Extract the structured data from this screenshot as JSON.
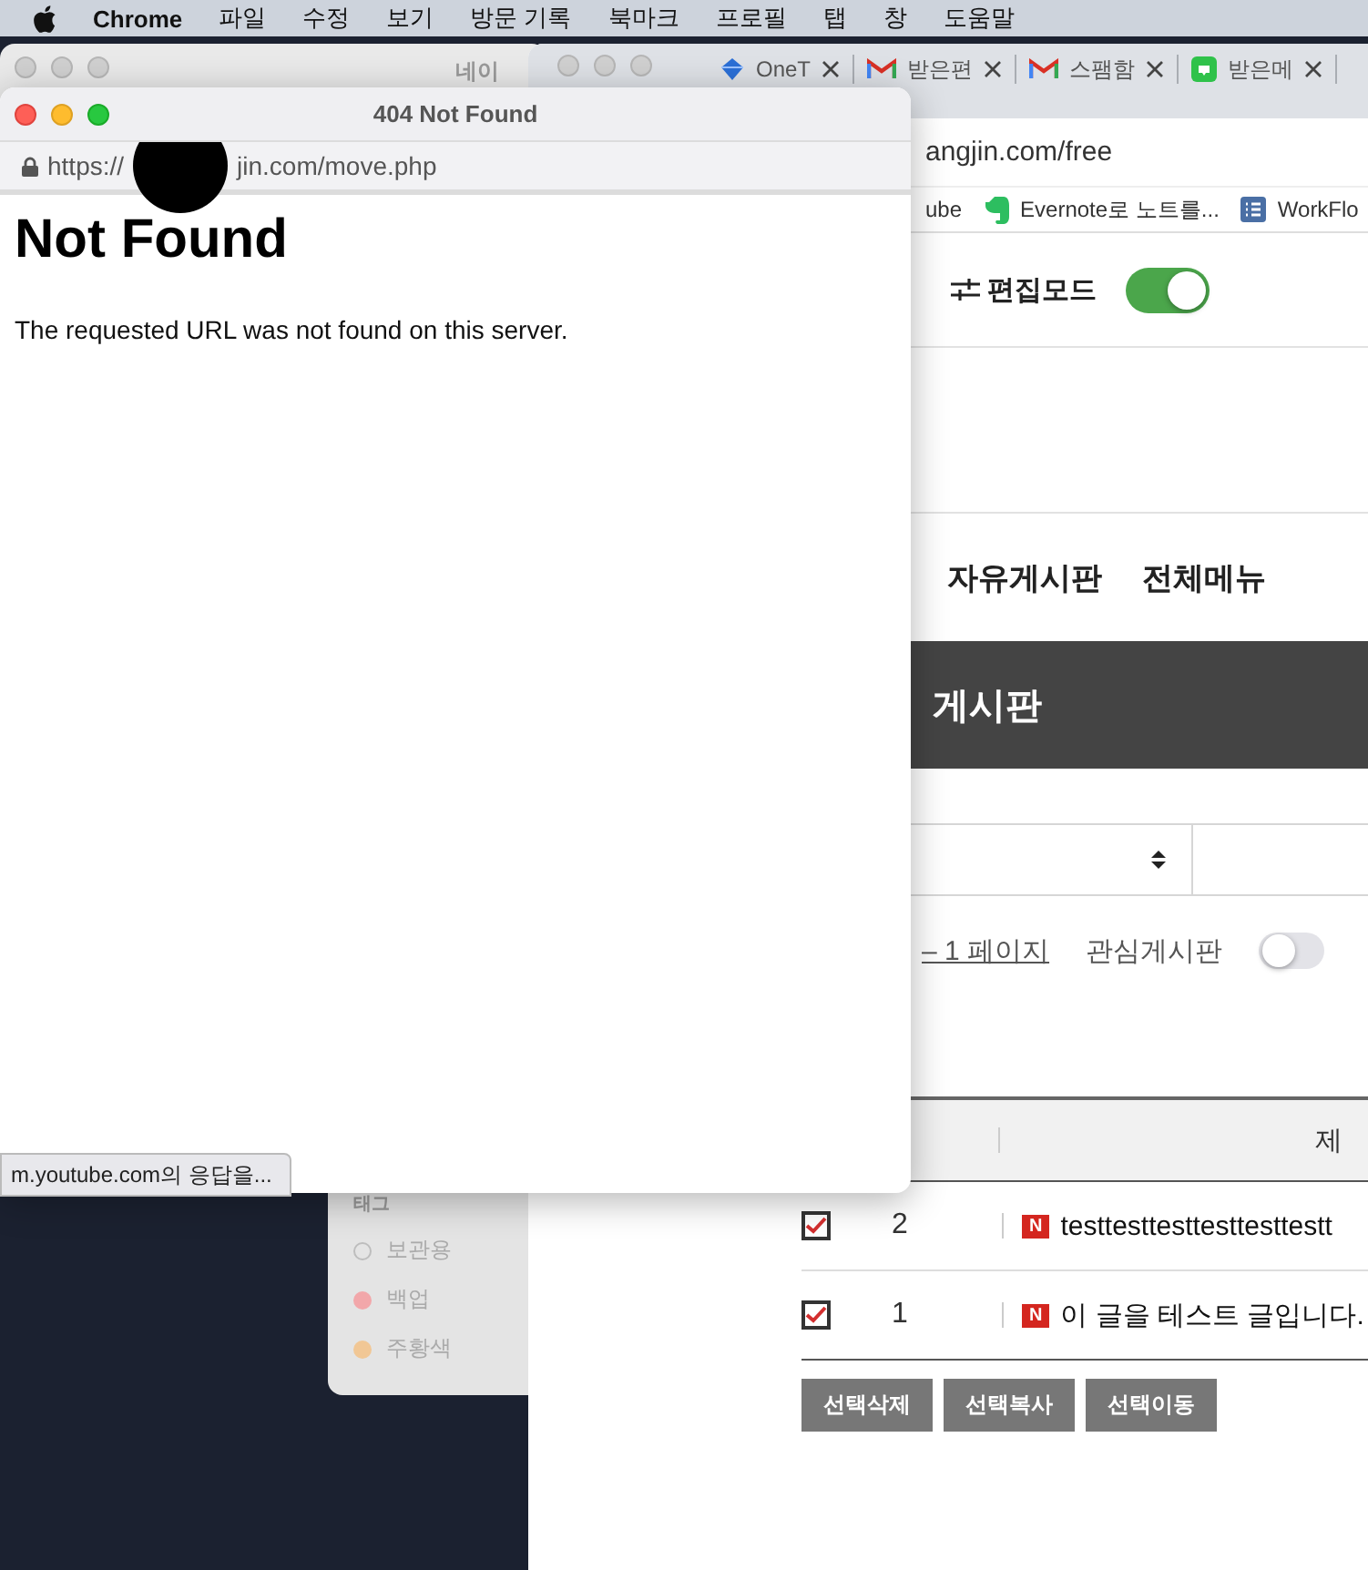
{
  "menu_bar": {
    "app": "Chrome",
    "items": [
      "파일",
      "수정",
      "보기",
      "방문 기록",
      "북마크",
      "프로필",
      "탭",
      "창",
      "도움말"
    ]
  },
  "back_window": {
    "title": "네이",
    "tag_panel": {
      "heading": "태그",
      "tags": [
        {
          "label": "보관용",
          "kind": "outline",
          "color": "#bdbdbd"
        },
        {
          "label": "백업",
          "kind": "filled",
          "color": "#f2a7aa"
        },
        {
          "label": "주황색",
          "kind": "filled",
          "color": "#f1c795"
        }
      ]
    }
  },
  "chrome_window": {
    "tabs": [
      {
        "title": "OneT",
        "kind": "diamond",
        "selected": false
      },
      {
        "title": "받은편",
        "kind": "mail",
        "selected": false
      },
      {
        "title": "스팸함",
        "kind": "mail",
        "selected": false
      },
      {
        "title": "받은메",
        "kind": "bubble",
        "selected": false
      }
    ],
    "address": "angjin.com/free",
    "bookmarks": [
      {
        "label": "ube",
        "kind": "none"
      },
      {
        "label": "Evernote로 노트를...",
        "kind": "elephant"
      },
      {
        "label": "WorkFlo",
        "kind": "list"
      }
    ],
    "edit_mode": {
      "label": "편집모드",
      "on": true
    },
    "nav": [
      "자유게시판",
      "전체메뉴"
    ],
    "banner_title": "게시판",
    "page_link": "– 1 페이지",
    "favorite": {
      "label": "관심게시판",
      "on": false
    },
    "table": {
      "header": "제",
      "rows": [
        {
          "checked": true,
          "number": "2",
          "badge": "N",
          "title": "testtesttesttesttesttestt"
        },
        {
          "checked": true,
          "number": "1",
          "badge": "N",
          "title": "이 글을 테스트 글입니다."
        }
      ]
    },
    "buttons": [
      "선택삭제",
      "선택복사",
      "선택이동"
    ]
  },
  "popup": {
    "title": "404 Not Found",
    "url_prefix": "https://",
    "url_suffix": "jin.com/move.php",
    "heading": "Not Found",
    "message": "The requested URL was not found on this server."
  },
  "status_bubble": "m.youtube.com의 응답을..."
}
